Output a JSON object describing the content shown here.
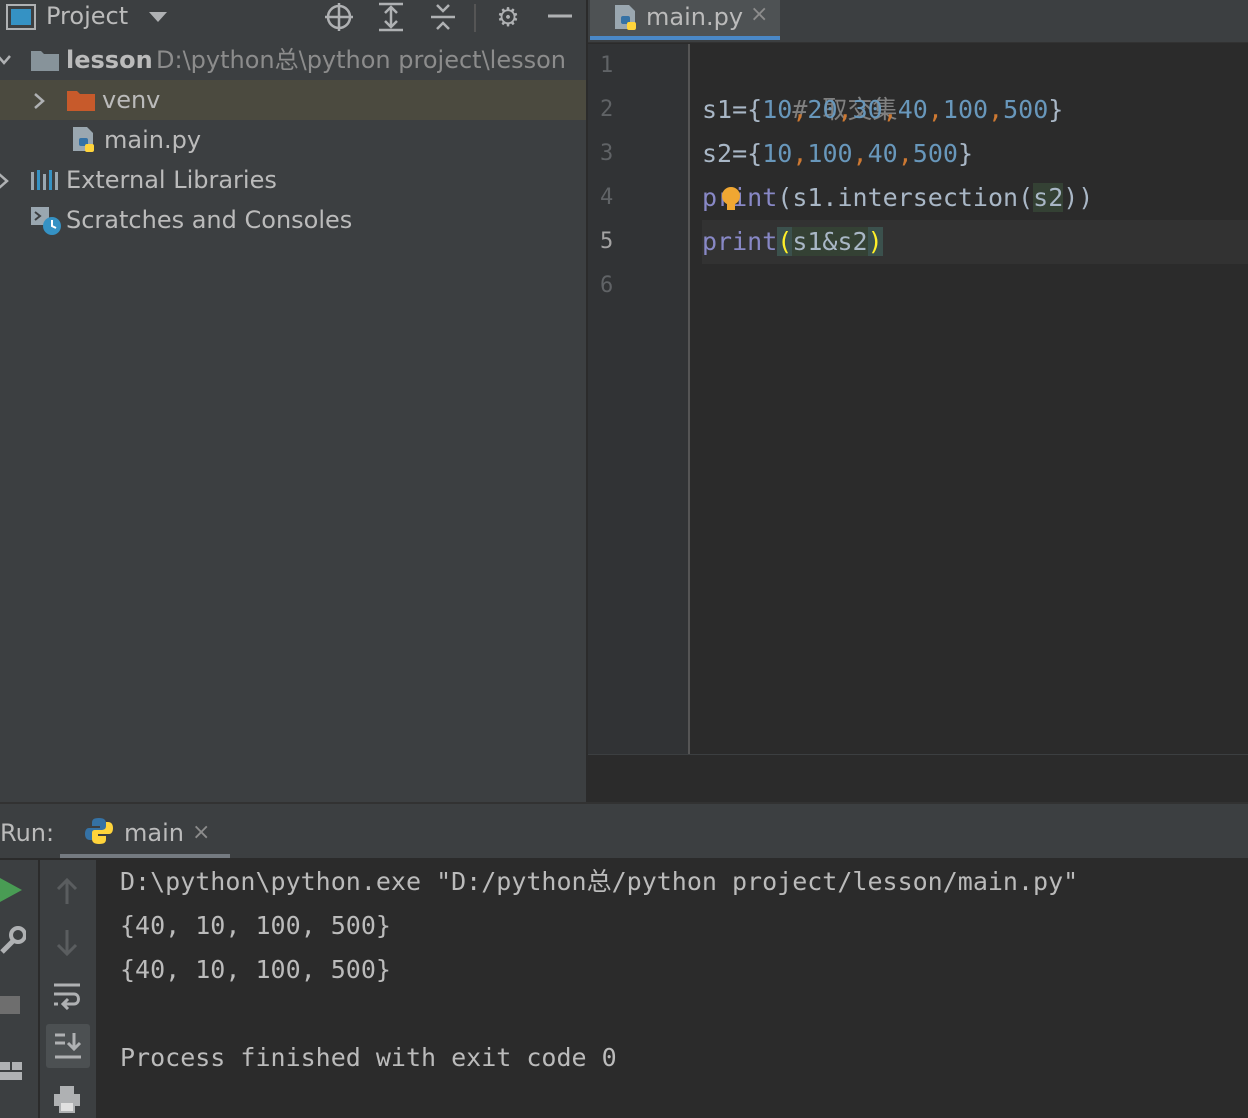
{
  "project_panel": {
    "title": "Project",
    "dropdown_icon": "caret-down-icon",
    "toolbar_icons": [
      "locate-icon",
      "expand-all-icon",
      "collapse-all-icon",
      "gear-icon",
      "minimize-icon"
    ],
    "tree": [
      {
        "label": "lesson",
        "path": "D:\\python总\\python project\\lesson",
        "icon": "folder-icon",
        "expanded": true
      },
      {
        "label": "venv",
        "icon": "folder-excluded-icon",
        "expanded": false,
        "selected": true
      },
      {
        "label": "main.py",
        "icon": "python-file-icon"
      },
      {
        "label": "External Libraries",
        "icon": "library-icon",
        "expanded": false
      },
      {
        "label": "Scratches and Consoles",
        "icon": "scratches-icon"
      }
    ]
  },
  "editor": {
    "tab": {
      "label": "main.py",
      "icon": "python-file-icon",
      "close": "×"
    },
    "line_numbers": [
      "1",
      "2",
      "3",
      "4",
      "5",
      "6"
    ],
    "current_line": "5",
    "code": {
      "line1": {
        "comment": "# 取交集"
      },
      "line2": {
        "t1": "s1={",
        "n1": "10",
        "c1": ",",
        "n2": "20",
        "c2": ",",
        "n3": "30",
        "c3": ",",
        "n4": "40",
        "c4": ",",
        "n5": "100",
        "c5": ",",
        "n6": "500",
        "t2": "}"
      },
      "line3": {
        "t1": "s2={",
        "n1": "10",
        "c1": ",",
        "n2": "100",
        "c2": ",",
        "n3": "40",
        "c3": ",",
        "n4": "500",
        "t2": "}"
      },
      "line4": {
        "fn": "print",
        "t1": "(s1.intersection(",
        "v": "s2",
        "t2": "))"
      },
      "line5": {
        "fn": "print",
        "p1": "(",
        "v1": "s1&",
        "v2": "s2",
        "p2": ")"
      }
    },
    "intention_icon": "lightbulb-icon"
  },
  "run_panel": {
    "label": "Run:",
    "tab": {
      "label": "main",
      "icon": "python-icon",
      "close": "×"
    },
    "toolbar_icons": [
      "rerun-icon",
      "wrench-icon",
      "stop-icon",
      "layout-icon",
      "up-arrow-icon",
      "down-arrow-icon",
      "soft-wrap-icon",
      "scroll-to-end-icon",
      "print-icon"
    ],
    "output": [
      "D:\\python\\python.exe \"D:/python总/python project/lesson/main.py\"",
      "{40, 10, 100, 500}",
      "{40, 10, 100, 500}",
      "",
      "Process finished with exit code 0"
    ]
  },
  "colors": {
    "panel_bg": "#3c3f41",
    "editor_bg": "#2b2b2b",
    "selection": "#4b4a3f",
    "number": "#6897bb",
    "builtin": "#8888c6",
    "comment": "#808080",
    "accent": "#4a88c7"
  }
}
